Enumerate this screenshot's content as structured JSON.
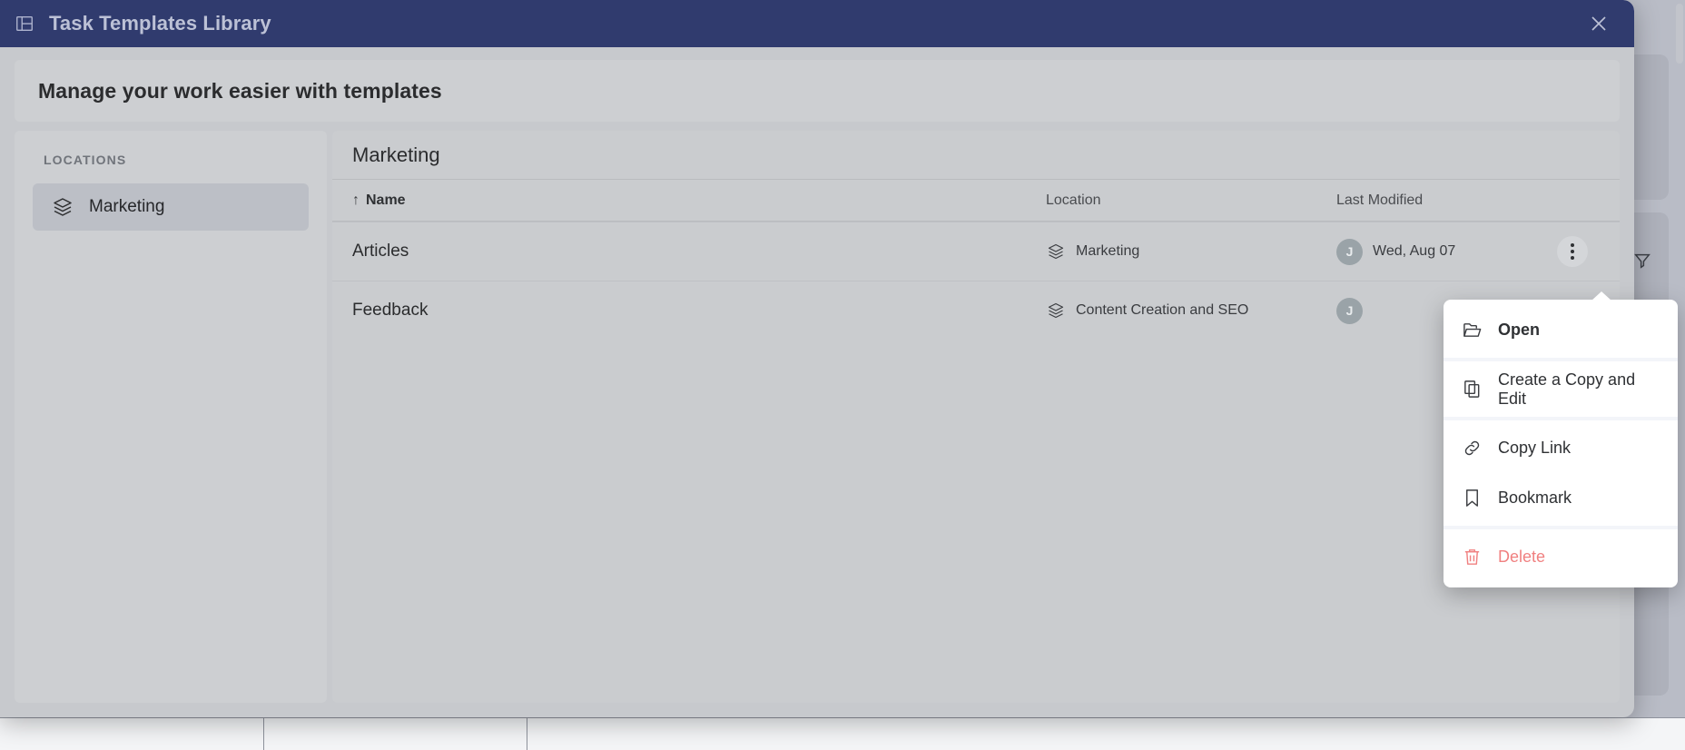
{
  "window": {
    "title": "Task Templates Library",
    "icon": "layout-panel-icon",
    "close_icon": "close-icon"
  },
  "banner": {
    "title": "Manage your work easier with templates"
  },
  "sidebar": {
    "heading": "LOCATIONS",
    "items": [
      {
        "label": "Marketing",
        "icon": "layers-icon",
        "active": true
      }
    ]
  },
  "panel": {
    "title": "Marketing",
    "columns": {
      "name": "Name",
      "name_sort_arrow": "↑",
      "location": "Location",
      "last_modified": "Last Modified"
    },
    "rows": [
      {
        "name": "Articles",
        "location": "Marketing",
        "location_icon": "layers-icon",
        "avatar_initial": "J",
        "last_modified": "Wed, Aug 07",
        "menu_open": true
      },
      {
        "name": "Feedback",
        "location": "Content Creation and SEO",
        "location_icon": "layers-icon",
        "avatar_initial": "J",
        "last_modified": "",
        "menu_open": false
      }
    ]
  },
  "context_menu": {
    "items": [
      {
        "label": "Open",
        "icon": "folder-open-icon",
        "style": "bold"
      },
      {
        "label": "Create a Copy and Edit",
        "icon": "copy-icon",
        "style": "normal"
      },
      {
        "label": "Copy Link",
        "icon": "link-icon",
        "style": "normal"
      },
      {
        "label": "Bookmark",
        "icon": "bookmark-icon",
        "style": "normal"
      },
      {
        "label": "Delete",
        "icon": "trash-icon",
        "style": "danger"
      }
    ]
  },
  "colors": {
    "titlebar": "#303b6e",
    "titlebar_text": "#bcc1d6",
    "modal_bg": "#c7c9cd",
    "panel_bg": "#cacccf",
    "danger": "#f08080",
    "avatar_bg": "#9aa3a8"
  },
  "background_app": {
    "rail_icons": [
      "filter-icon",
      "plus-icon",
      "more-vertical-icon"
    ]
  }
}
